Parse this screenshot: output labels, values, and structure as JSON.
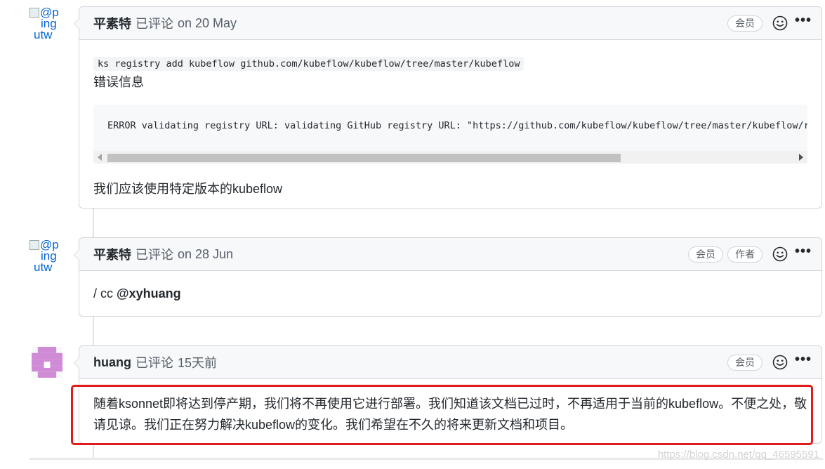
{
  "comments": [
    {
      "avatar_alt": [
        "@p",
        "ing",
        "utw"
      ],
      "author": "平素特",
      "action": "已评论",
      "time": "on 20 May",
      "badges": [
        "会员"
      ],
      "code_inline": "ks registry add kubeflow github.com/kubeflow/kubeflow/tree/master/kubeflow",
      "error_label": "错误信息",
      "error_code": "ERROR validating registry URL: validating GitHub registry URL: \"https://github.com/kubeflow/kubeflow/tree/master/kubeflow/r",
      "closing_text": "我们应该使用特定版本的kubeflow"
    },
    {
      "avatar_alt": [
        "@p",
        "ing",
        "utw"
      ],
      "author": "平素特",
      "action": "已评论",
      "time": "on 28 Jun",
      "badges": [
        "会员",
        "作者"
      ],
      "text_prefix": "/ cc ",
      "mention": "@xyhuang"
    },
    {
      "avatar": "identicon",
      "author": "huang",
      "action": "已评论",
      "time": "15天前",
      "badges": [
        "会员"
      ],
      "text": "随着ksonnet即将达到停产期，我们将不再使用它进行部署。我们知道该文档已过时，不再适用于当前的kubeflow。不便之处，敬请见谅。我们正在努力解决kubeflow的变化。我们希望在不久的将来更新文档和项目。"
    }
  ],
  "icons": {
    "reaction": "smiley-icon",
    "more": "kebab-horizontal-icon"
  },
  "more_glyph": "•••",
  "watermark": "https://blog.csdn.net/qq_46595591",
  "colors": {
    "highlight": "#e01b1b",
    "header_bg": "#f6f8fa",
    "border": "#d1d5da",
    "identicon": "#d08bd6"
  }
}
